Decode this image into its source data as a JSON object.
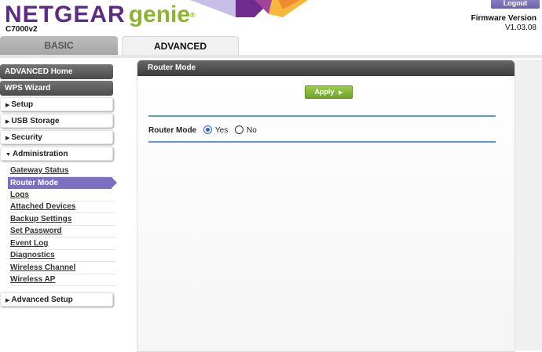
{
  "header": {
    "logo_brand": "NETGEAR",
    "logo_product": "genie",
    "logo_mark": "®",
    "model": "C7000v2",
    "logout_label": "Logout",
    "firmware_label": "Firmware Version",
    "firmware_value": "V1.03.08"
  },
  "tabs": [
    {
      "label": "BASIC"
    },
    {
      "label": "ADVANCED"
    }
  ],
  "sidebar": {
    "advanced_home": "ADVANCED Home",
    "wps_wizard": "WPS Wizard",
    "setup": "Setup",
    "usb_storage": "USB Storage",
    "security": "Security",
    "administration": "Administration",
    "admin_items": [
      {
        "label": "Gateway Status"
      },
      {
        "label": "Router Mode"
      },
      {
        "label": "Logs"
      },
      {
        "label": "Attached Devices"
      },
      {
        "label": "Backup Settings"
      },
      {
        "label": "Set Password"
      },
      {
        "label": "Event Log"
      },
      {
        "label": "Diagnostics"
      },
      {
        "label": "Wireless Channel"
      },
      {
        "label": "Wireless AP"
      }
    ],
    "advanced_setup": "Advanced Setup",
    "active_item": "Router Mode"
  },
  "main": {
    "panel_title": "Router Mode",
    "apply_label": "Apply",
    "field_label": "Router Mode",
    "options": [
      {
        "label": "Yes",
        "selected": true
      },
      {
        "label": "No",
        "selected": false
      }
    ]
  },
  "colors": {
    "brand_purple": "#5a2d82",
    "brand_green": "#8db42d",
    "active_item": "#7d6fbf",
    "apply_button": "#7fb13a",
    "divider_blue": "#5b9bd5"
  },
  "icons": {
    "collapsed": "triangle-right-icon",
    "expanded": "triangle-down-icon",
    "apply": "play-arrow-icon"
  }
}
